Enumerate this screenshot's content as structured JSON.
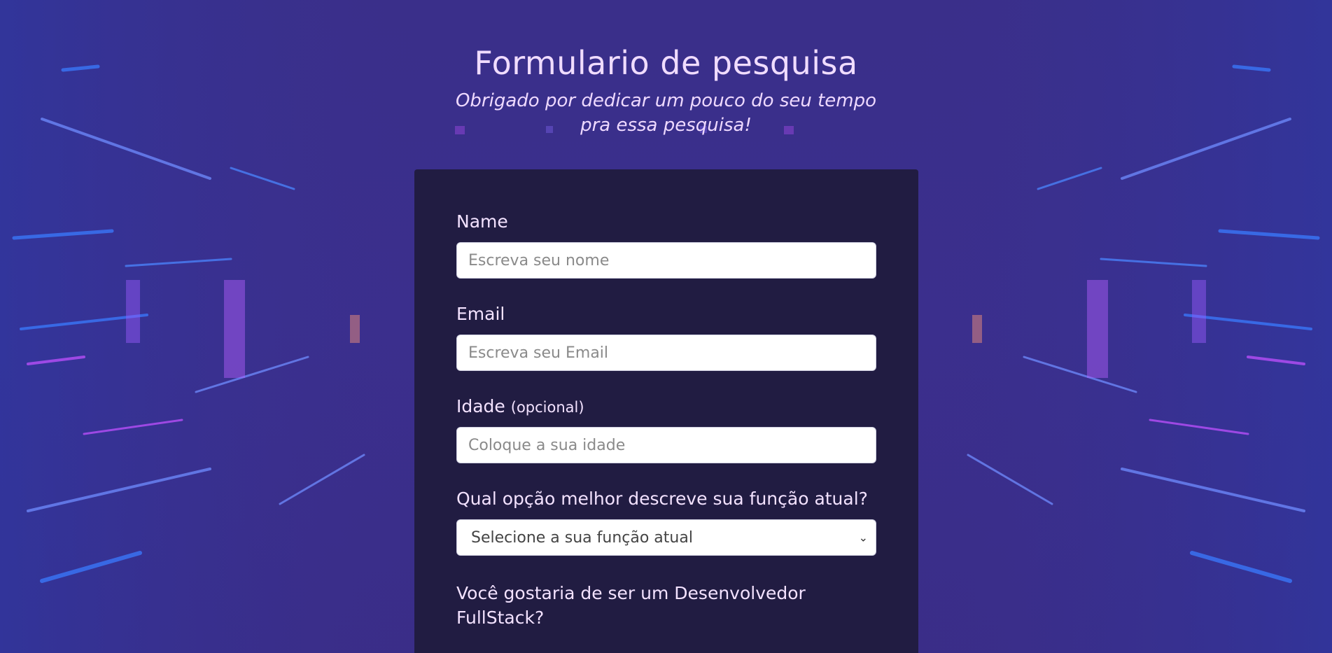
{
  "header": {
    "title": "Formulario de pesquisa",
    "subtitle": "Obrigado por dedicar um pouco do seu tempo pra essa pesquisa!"
  },
  "form": {
    "name": {
      "label": "Name",
      "placeholder": "Escreva seu nome"
    },
    "email": {
      "label": "Email",
      "placeholder": "Escreva seu Email"
    },
    "age": {
      "label": "Idade",
      "label_suffix": "(opcional)",
      "placeholder": "Coloque a sua idade"
    },
    "role": {
      "label": "Qual opção melhor descreve sua função atual?",
      "selected": "Selecione a sua função atual",
      "chevron_icon": "chevron-down-icon"
    },
    "fullstack_question": "Você gostaria de ser um Desenvolvedor FullStack?"
  },
  "colors": {
    "background": "#3b2f8d",
    "card": "#201b3c",
    "text": "#f3e2ff",
    "neon_blue": "#3a7bff",
    "neon_pink": "#c050ff"
  }
}
